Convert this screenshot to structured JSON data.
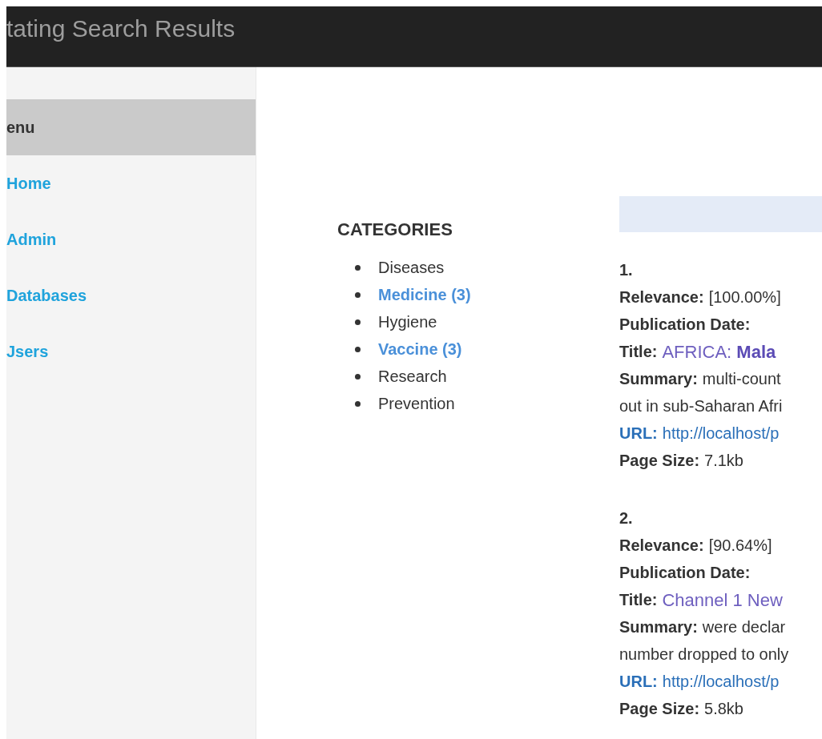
{
  "header": {
    "title": "tating Search Results"
  },
  "sidebar": {
    "heading": "enu",
    "items": [
      {
        "label": "Home"
      },
      {
        "label": "Admin"
      },
      {
        "label": "Databases"
      },
      {
        "label": "Jsers"
      }
    ]
  },
  "categories": {
    "heading": "CATEGORIES",
    "items": [
      {
        "label": "Diseases",
        "kind": "plain"
      },
      {
        "label": "Medicine (3)",
        "kind": "link"
      },
      {
        "label": "Hygiene",
        "kind": "plain"
      },
      {
        "label": "Vaccine (3)",
        "kind": "link"
      },
      {
        "label": "Research",
        "kind": "plain"
      },
      {
        "label": "Prevention",
        "kind": "plain"
      }
    ]
  },
  "results": [
    {
      "number": "1.",
      "relevance_label": "Relevance:",
      "relevance": "[100.00%]",
      "date_label": "Publication Date:",
      "title_label": "Title:",
      "title": "AFRICA: **Mala**",
      "summary_label": "Summary:",
      "summary_lines": [
        "multi-count",
        "out in sub-Saharan Afri"
      ],
      "url_label": "URL:",
      "url": "http://localhost/p",
      "size_label": "Page Size:",
      "size": "7.1kb"
    },
    {
      "number": "2.",
      "relevance_label": "Relevance:",
      "relevance": "[90.64%]",
      "date_label": "Publication Date:",
      "title_label": "Title:",
      "title": "Channel 1 New",
      "summary_label": "Summary:",
      "summary_lines": [
        "were declar",
        "number dropped to only"
      ],
      "url_label": "URL:",
      "url": "http://localhost/p",
      "size_label": "Page Size:",
      "size": "5.8kb"
    }
  ]
}
